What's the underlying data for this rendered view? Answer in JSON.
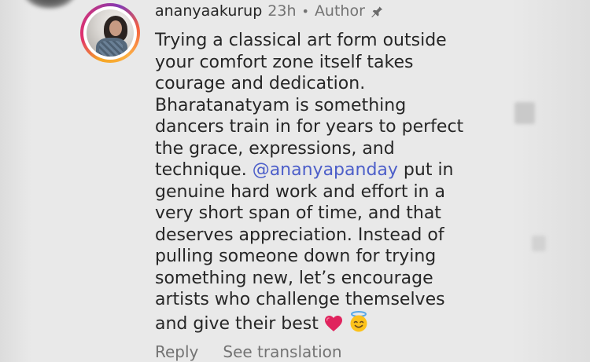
{
  "comment": {
    "username": "ananyaakurup",
    "timestamp": "23h",
    "separator": "•",
    "author_badge": "Author",
    "pinned_icon": "pin-icon",
    "text_lines": [
      "Trying a classical art form outside",
      "your comfort zone itself takes",
      "courage and dedication.",
      "Bharatanatyam is something",
      "dancers train in for years to perfect",
      "the grace, expressions, and",
      "technique.",
      "@ananyapanday",
      "put in",
      "genuine hard work and effort in a",
      "very short span of time, and that",
      "deserves appreciation. Instead of",
      "pulling someone down for trying",
      "something new, let’s encourage",
      "artists who challenge themselves",
      "and give their best"
    ],
    "emojis": [
      "heart-emoji",
      "angel-emoji"
    ],
    "actions": {
      "reply": "Reply",
      "see_translation": "See translation"
    }
  },
  "colors": {
    "background": "#e9e9e9",
    "text": "#262626",
    "muted": "#737373",
    "mention": "#4c5ec9",
    "heart": "#e0245e"
  }
}
